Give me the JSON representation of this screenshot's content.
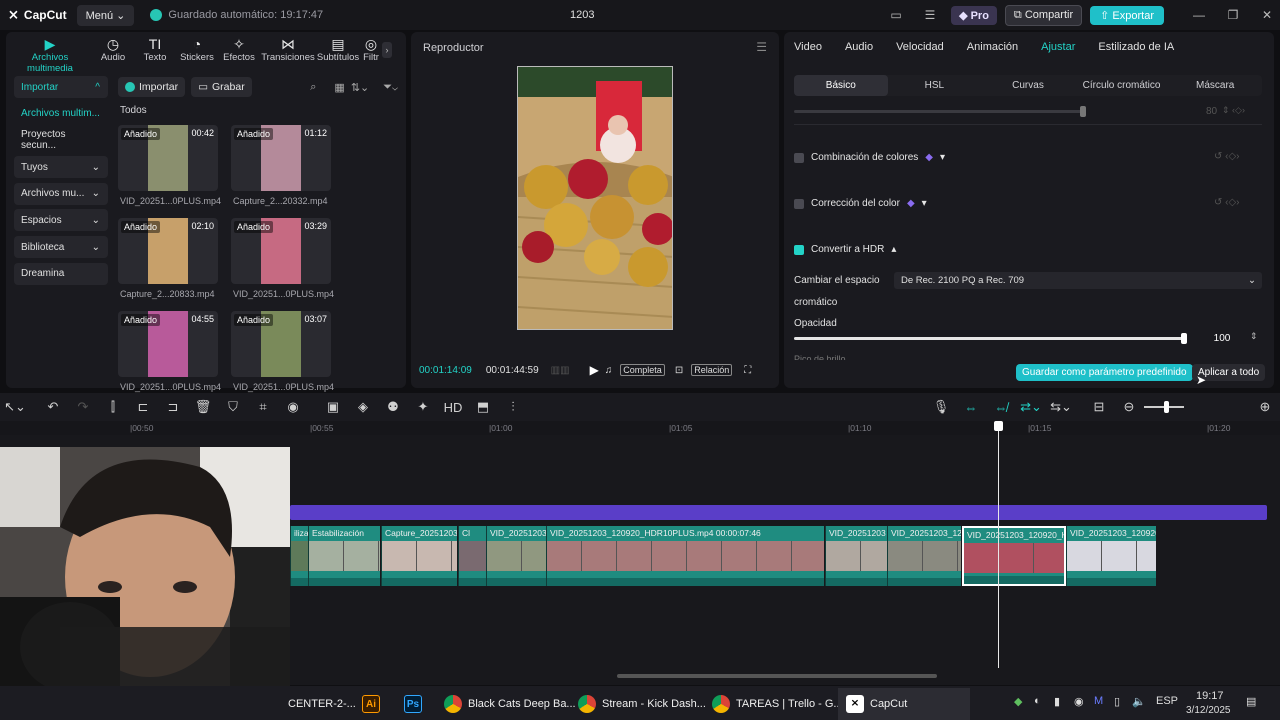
{
  "titlebar": {
    "app_name": "CapCut",
    "menu_label": "Menú",
    "autosave_text": "Guardado automático: 19:17:47",
    "project_title": "1203",
    "pro_label": "Pro",
    "share_label": "Compartir",
    "export_label": "Exportar"
  },
  "media_tabs": [
    {
      "label": "Archivos multimedia",
      "icon": "media-icon"
    },
    {
      "label": "Audio",
      "icon": "audio-icon"
    },
    {
      "label": "Texto",
      "icon": "text-icon"
    },
    {
      "label": "Stickers",
      "icon": "stickers-icon"
    },
    {
      "label": "Efectos",
      "icon": "effects-icon"
    },
    {
      "label": "Transiciones",
      "icon": "transitions-icon"
    },
    {
      "label": "Subtítulos",
      "icon": "subtitles-icon"
    },
    {
      "label": "Filtr",
      "icon": "filters-icon"
    }
  ],
  "side_nav": [
    {
      "label": "Importar",
      "chev": "^"
    },
    {
      "label": "Archivos multim...",
      "chev": ""
    },
    {
      "label": "Proyectos secun...",
      "chev": ""
    },
    {
      "label": "Tuyos",
      "chev": "⌄"
    },
    {
      "label": "Archivos mu...",
      "chev": "⌄"
    },
    {
      "label": "Espacios",
      "chev": "⌄"
    },
    {
      "label": "Biblioteca",
      "chev": "⌄"
    },
    {
      "label": "Dreamina",
      "chev": ""
    }
  ],
  "media_toolbar": {
    "import_label": "Importar",
    "record_label": "Grabar",
    "all_label": "Todos"
  },
  "media_items": [
    {
      "badge": "Añadido",
      "duration": "00:42",
      "name": "VID_20251...0PLUS.mp4",
      "color": "#8a8f6e"
    },
    {
      "badge": "Añadido",
      "duration": "01:12",
      "name": "Capture_2...20332.mp4",
      "color": "#b48a9a"
    },
    {
      "badge": "Añadido",
      "duration": "02:10",
      "name": "Capture_2...20833.mp4",
      "color": "#c7a06a"
    },
    {
      "badge": "Añadido",
      "duration": "03:29",
      "name": "VID_20251...0PLUS.mp4",
      "color": "#c66a82"
    },
    {
      "badge": "Añadido",
      "duration": "04:55",
      "name": "VID_20251...0PLUS.mp4",
      "color": "#b85a9a"
    },
    {
      "badge": "Añadido",
      "duration": "03:07",
      "name": "VID_20251...0PLUS.mp4",
      "color": "#7a8a5a"
    }
  ],
  "player": {
    "title": "Reproductor",
    "current_time": "00:01:14:09",
    "total_time": "00:01:44:59",
    "full_label": "Completa",
    "ratio_label": "Relación"
  },
  "inspector": {
    "tabs": [
      "Video",
      "Audio",
      "Velocidad",
      "Animación",
      "Ajustar",
      "Estilizado de IA"
    ],
    "active_tab": "Ajustar",
    "subtabs": [
      "Básico",
      "HSL",
      "Curvas",
      "Círculo cromático",
      "Máscara"
    ],
    "active_subtab": "Básico",
    "top_value": "80",
    "color_match_label": "Combinación de colores",
    "color_correction_label": "Corrección del color",
    "hdr_label": "Convertir a HDR",
    "color_space_label_1": "Cambiar el espacio",
    "color_space_label_2": "cromático",
    "color_space_value": "De Rec. 2100 PQ a Rec. 709",
    "opacity_label": "Opacidad",
    "opacity_value": "100",
    "cut_label": "Pico de brillo",
    "save_preset_label": "Guardar como parámetro predefinido",
    "apply_all_label": "Aplicar a todo"
  },
  "ruler_labels": [
    "|00:50",
    "|00:55",
    "|01:00",
    "|01:05",
    "|01:10",
    "|01:15",
    "|01:20"
  ],
  "clips": [
    {
      "label": "ilizac",
      "color": "#5e7a5a"
    },
    {
      "label": "Estabilización",
      "color": "#a5b0a0"
    },
    {
      "label": "Ca",
      "color": "#8a7a80"
    },
    {
      "label": "Capture_20251203_",
      "color": "#c8b8b0"
    },
    {
      "label": "Cl",
      "color": "#7a6a70"
    },
    {
      "label": "VID_20251203",
      "color": "#909880"
    },
    {
      "label": "VID_20251203_120920_HDR10PLUS.mp4   00:00:07:46",
      "color": "#a87a7a"
    },
    {
      "label": "VID_20251203",
      "color": "#b0a8a0"
    },
    {
      "label": "VID_20251203_120",
      "color": "#8a8a80"
    },
    {
      "label": "VID_20251203_120920_H",
      "color": "#b05060"
    },
    {
      "label": "VID_20251203_120920",
      "color": "#d8d8e0"
    }
  ],
  "taskbar": {
    "items": [
      {
        "label": "CENTER-2-...",
        "icon": "window-icon"
      },
      {
        "label": "",
        "icon": "illustrator-icon",
        "glyph": "Ai"
      },
      {
        "label": "",
        "icon": "photoshop-icon",
        "glyph": "Ps"
      },
      {
        "label": "Black Cats Deep Ba...",
        "icon": "chrome-icon"
      },
      {
        "label": "Stream - Kick Dash...",
        "icon": "chrome-icon"
      },
      {
        "label": "TAREAS | Trello - G...",
        "icon": "chrome-icon"
      },
      {
        "label": "CapCut",
        "icon": "capcut-icon"
      }
    ],
    "lang": "ESP",
    "time": "19:17",
    "date": "3/12/2025"
  }
}
